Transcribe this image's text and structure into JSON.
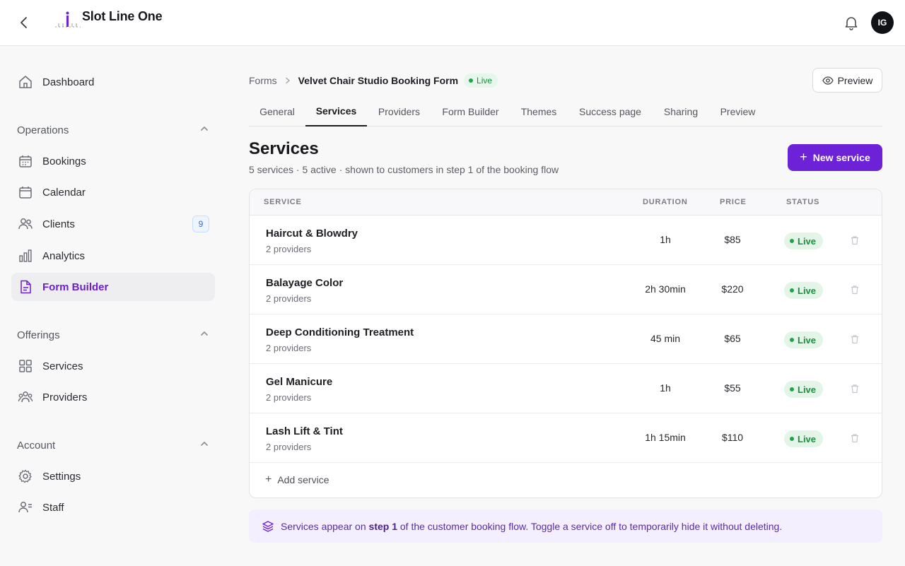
{
  "app": {
    "title": "Slot Line One",
    "avatar_initials": "IG"
  },
  "sidebar": {
    "items": [
      {
        "label": "Dashboard",
        "icon": "home-icon"
      }
    ],
    "sections": [
      {
        "label": "Operations",
        "items": [
          {
            "label": "Bookings",
            "icon": "calendar-grid-icon"
          },
          {
            "label": "Calendar",
            "icon": "calendar-icon"
          },
          {
            "label": "Clients",
            "icon": "users-icon",
            "badge": "9"
          },
          {
            "label": "Analytics",
            "icon": "bar-chart-icon"
          },
          {
            "label": "Form Builder",
            "icon": "document-icon",
            "active": true
          }
        ]
      },
      {
        "label": "Offerings",
        "items": [
          {
            "label": "Services",
            "icon": "grid-icon"
          },
          {
            "label": "Providers",
            "icon": "team-icon"
          }
        ]
      },
      {
        "label": "Account",
        "items": [
          {
            "label": "Settings",
            "icon": "gear-icon"
          },
          {
            "label": "Staff",
            "icon": "staff-icon"
          }
        ]
      }
    ]
  },
  "breadcrumb": {
    "root": "Forms",
    "current": "Velvet Chair Studio Booking Form",
    "status": "Live"
  },
  "header": {
    "preview_label": "Preview"
  },
  "tabs": [
    "General",
    "Services",
    "Providers",
    "Form Builder",
    "Themes",
    "Success page",
    "Sharing",
    "Preview"
  ],
  "active_tab": "Services",
  "page": {
    "title": "Services",
    "subtitle": "5 services · 5 active · shown to customers in step 1 of the booking flow",
    "new_button": "New service"
  },
  "table": {
    "columns": [
      "SERVICE",
      "DURATION",
      "PRICE",
      "STATUS"
    ],
    "rows": [
      {
        "name": "Haircut & Blowdry",
        "providers": "2 providers",
        "duration": "1h",
        "price": "$85",
        "status": "Live"
      },
      {
        "name": "Balayage Color",
        "providers": "2 providers",
        "duration": "2h 30min",
        "price": "$220",
        "status": "Live"
      },
      {
        "name": "Deep Conditioning Treatment",
        "providers": "2 providers",
        "duration": "45 min",
        "price": "$65",
        "status": "Live"
      },
      {
        "name": "Gel Manicure",
        "providers": "2 providers",
        "duration": "1h",
        "price": "$55",
        "status": "Live"
      },
      {
        "name": "Lash Lift & Tint",
        "providers": "2 providers",
        "duration": "1h 15min",
        "price": "$110",
        "status": "Live"
      }
    ],
    "add_label": "Add service"
  },
  "info": {
    "before": "Services appear on ",
    "bold": "step 1",
    "after": " of the customer booking flow. Toggle a service off to temporarily hide it without deleting."
  },
  "colors": {
    "accent": "#6d22d8",
    "live_green": "#1a8f3c",
    "info_bg": "#f4efff"
  }
}
